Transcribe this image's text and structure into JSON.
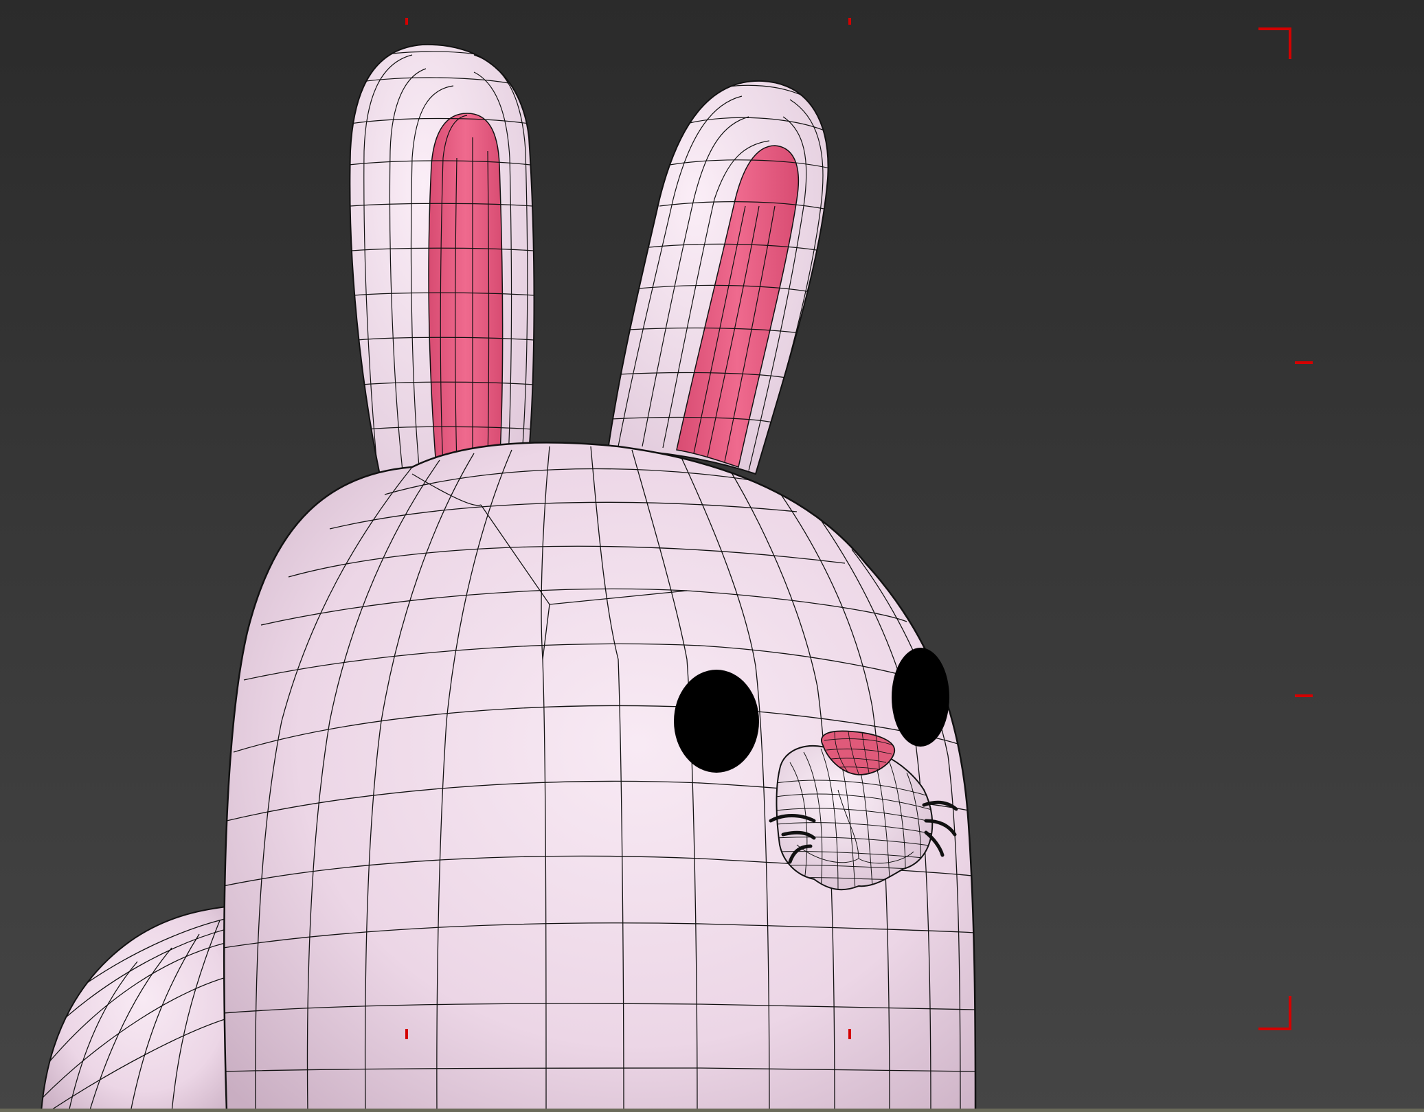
{
  "viewport": {
    "background": "#3a3a3a",
    "background_top": "#2c2c2c",
    "safe_frame_color": "#d40000"
  },
  "model": {
    "subject": "bunny",
    "body_color": "#f3e2ef",
    "inner_ear_color": "#e85c82",
    "nose_color": "#e05a7a",
    "eye_color": "#000000",
    "wire_color": "#111111",
    "whisker_color": "#111111"
  }
}
